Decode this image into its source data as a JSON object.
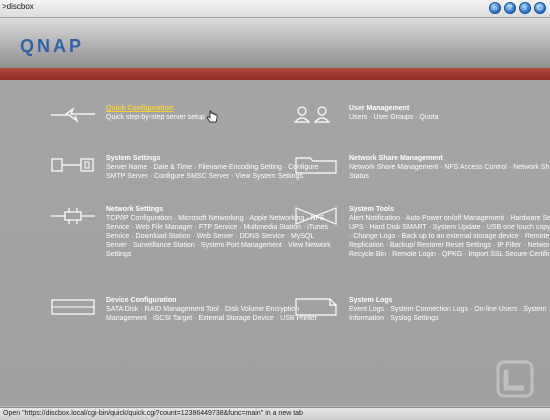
{
  "window": {
    "breadcrumb": ">discbox",
    "top_icons": [
      "home-icon",
      "help-icon",
      "info-icon",
      "logout-icon"
    ]
  },
  "brand": {
    "logo_text": "QNAP"
  },
  "menu": {
    "quick_config": {
      "title": "Quick Configuration",
      "desc": "Quick step-by-step server setup"
    },
    "user_mgmt": {
      "title": "User Management",
      "desc": "Users · User Groups · Quota"
    },
    "system_settings": {
      "title": "System Settings",
      "desc": "Server Name · Date & Time · Filename Encoding Setting · Configure SMTP Server · Configure SMSC Server · View System Settings"
    },
    "network_share": {
      "title": "Network Share Management",
      "desc": "Network Share Management · NFS Access Control · Network Share Status"
    },
    "network_settings": {
      "title": "Network Settings",
      "desc": "TCP/IP Configuration · Microsoft Networking · Apple Networking · NFS Service · Web File Manager · FTP Service · Multimedia Station · iTunes Service · Download Station · Web Server · DDNS Service · MySQL Server · Surveillance Station · System Port Management · View Network Settings"
    },
    "system_tools": {
      "title": "System Tools",
      "desc": "Alert Notification · Auto Power on/off Management · Hardware Settings · UPS · Hard Disk SMART · System Update · USB one touch copy backup · Change Logo · Back up to an external storage device · Remote Replication · Backup/ Restore/ Reset Settings · IP Filter · Network Recycle Bin · Remote Login · QPKG · Import SSL Secure Certificate"
    },
    "device_config": {
      "title": "Device Configuration",
      "desc": "SATA Disk · RAID Management Tool · Disk Volume Encryption Management · iSCSI Target · External Storage Device · USB Printer"
    },
    "system_logs": {
      "title": "System Logs",
      "desc": "Event Logs · System Connection Logs · On-line Users · System Information · Syslog Settings"
    }
  },
  "status": {
    "text": "Open \"https://discbox.local/cgi-bin/quick/quick.cgi?count=12386449738&func=main\" in a new tab"
  },
  "colors": {
    "accent_red": "#a63b33",
    "link_yellow": "#f6d23a",
    "logo_blue": "#2f63a7"
  }
}
